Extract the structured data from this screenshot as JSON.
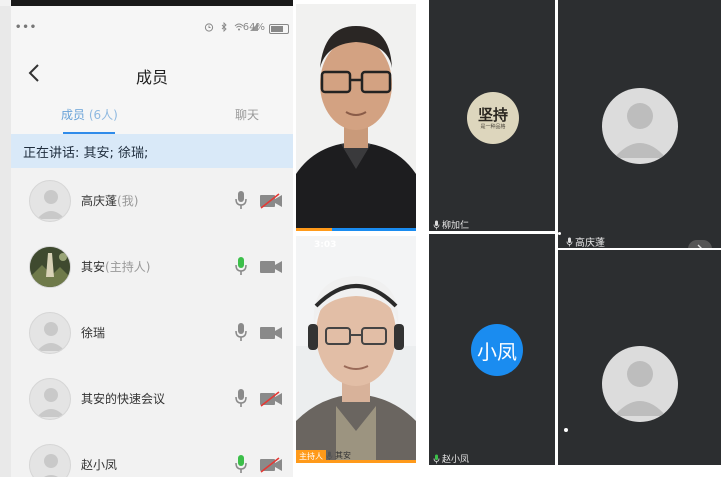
{
  "status_bar": {
    "dots": "•••",
    "battery": "64%"
  },
  "nav": {
    "title": "成员"
  },
  "tabs": {
    "members_label": "成员",
    "members_count": "(6人)",
    "chat_label": "聊天"
  },
  "speaking": {
    "text": "正在讲话: 其安; 徐瑞;"
  },
  "members": [
    {
      "name": "高庆蓬",
      "role": "(我)",
      "mic": "idle",
      "camera": "off"
    },
    {
      "name": "其安",
      "role": "(主持人)",
      "mic": "speaking",
      "camera": "on"
    },
    {
      "name": "徐瑞",
      "role": "",
      "mic": "idle",
      "camera": "on"
    },
    {
      "name": "其安的快速会议",
      "role": "",
      "mic": "idle",
      "camera": "off"
    },
    {
      "name": "赵小凤",
      "role": "",
      "mic": "speaking",
      "camera": "off"
    }
  ],
  "video_grid": {
    "tile_liu": {
      "label": "柳加仁",
      "logo_big": "坚持",
      "logo_small": "是一种品格"
    },
    "tile_gao": {
      "label": "高庆蓬"
    },
    "tile_host": {
      "timer": "3:03",
      "host_tag": "主持人",
      "label": "其安"
    },
    "tile_zhao": {
      "label": "赵小凤",
      "avatar_text": "小凤"
    },
    "next_icon": "chevron-right-icon"
  },
  "colors": {
    "accent_blue": "#2f8bea",
    "speaking_bg": "#d9e9f8",
    "mic_active": "#3cbf4a",
    "camera_off_red": "#e53935",
    "host_tag": "#ff9a1a",
    "tile_bg": "#2c2e30"
  }
}
